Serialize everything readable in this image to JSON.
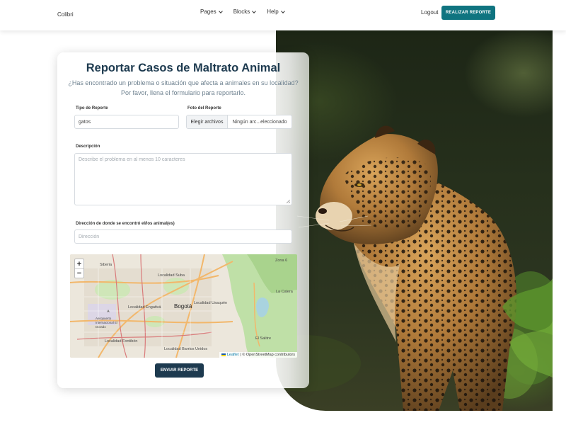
{
  "nav": {
    "brand": "Colibri",
    "menu": [
      {
        "label": "Pages"
      },
      {
        "label": "Blocks"
      },
      {
        "label": "Help"
      }
    ],
    "logout": "Logout",
    "cta": "REALIZAR REPORTE"
  },
  "form": {
    "title": "Reportar Casos de Maltrato Animal",
    "subtitle": "¿Has encontrado un problema o situación que afecta a animales en su localidad? Por favor, llena el formulario para reportarlo.",
    "tipo_label": "Tipo de Reporte",
    "tipo_value": "gatos",
    "foto_label": "Foto del Reporte",
    "file_button": "Elegir archivos",
    "file_status": "Ningún arc...eleccionado",
    "descripcion_label": "Descripción",
    "descripcion_placeholder": "Describe el problema en al menos 10 caracteres",
    "direccion_label": "Dirección de donde se encontró el/los animal(es)",
    "direccion_placeholder": "Dirección",
    "submit": "ENVIAR REPORTE"
  },
  "map": {
    "zoom_in": "+",
    "zoom_out": "−",
    "labels": {
      "siberia": "Siberia",
      "suba": "Localidad Suba",
      "engativa": "Localidad Engativá",
      "usaquen": "Localidad Usaquén",
      "bogota": "Bogotá",
      "aeropuerto": "Aeropuerto Internacional El Dorado",
      "fontibon": "Localidad Fontibón",
      "barrios_unidos": "Localidad Barrios Unidos",
      "zona6": "Zona 6",
      "la_calera": "La Calera",
      "el_salitre": "El Salitre"
    },
    "attribution_link": "Leaflet",
    "attribution_text": "| © OpenStreetMap contributors"
  },
  "colors": {
    "primary": "#0f7480",
    "dark": "#1d3a4f"
  },
  "hero_image": "jaguar-photo"
}
